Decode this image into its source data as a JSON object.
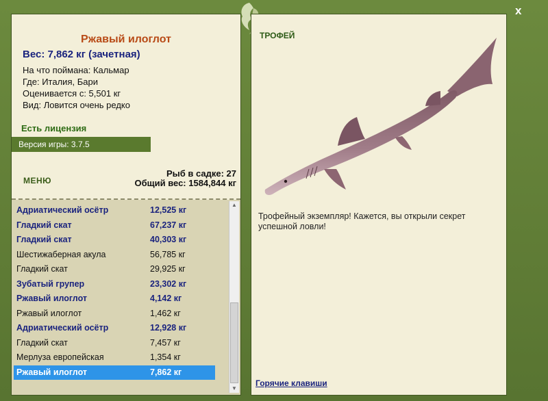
{
  "close_label": "x",
  "fish": {
    "title": "Ржавый илоглот",
    "weight_line": "Вес: 7,862 кг (зачетная)",
    "caught_on": "На что поймана: Кальмар",
    "where": "Где: Италия, Бари",
    "valued_from": "Оценивается с: 5,501 кг",
    "kind": "Вид: Ловится очень редко"
  },
  "license": "Есть лицензия",
  "version": "Версия игры: 3.7.5",
  "menu_label": "МЕНЮ",
  "keeper": {
    "count": "Рыб в садке: 27",
    "total": "Общий вес: 1584,844 кг"
  },
  "catch_list": [
    {
      "name": "Адриатический осётр",
      "weight": "12,525 кг",
      "bold": true
    },
    {
      "name": "Гладкий скат",
      "weight": "67,237 кг",
      "bold": true
    },
    {
      "name": "Гладкий скат",
      "weight": "40,303 кг",
      "bold": true
    },
    {
      "name": "Шестижаберная акула",
      "weight": "56,785 кг",
      "bold": false
    },
    {
      "name": "Гладкий скат",
      "weight": "29,925 кг",
      "bold": false
    },
    {
      "name": "Зубатый групер",
      "weight": "23,302 кг",
      "bold": true
    },
    {
      "name": "Ржавый илоглот",
      "weight": "4,142 кг",
      "bold": true
    },
    {
      "name": "Ржавый илоглот",
      "weight": "1,462 кг",
      "bold": false
    },
    {
      "name": "Адриатический осётр",
      "weight": "12,928 кг",
      "bold": true
    },
    {
      "name": "Гладкий скат",
      "weight": "7,457 кг",
      "bold": false
    },
    {
      "name": "Мерлуза европейская",
      "weight": "1,354 кг",
      "bold": false
    },
    {
      "name": "Ржавый илоглот",
      "weight": "7,862 кг",
      "bold": true,
      "selected": true
    }
  ],
  "trophy": {
    "label": "ТРОФЕЙ",
    "text": "Трофейный экземпляр! Кажется, вы открыли секрет успешной ловли!"
  },
  "hotkeys_label": "Горячие клавиши",
  "colors": {
    "frame": "#5e7a36",
    "panel": "#f3efd9",
    "list_bg": "#d9d4b4",
    "selected": "#2e94e8",
    "title": "#b84a16",
    "bold_text": "#1a237e"
  }
}
